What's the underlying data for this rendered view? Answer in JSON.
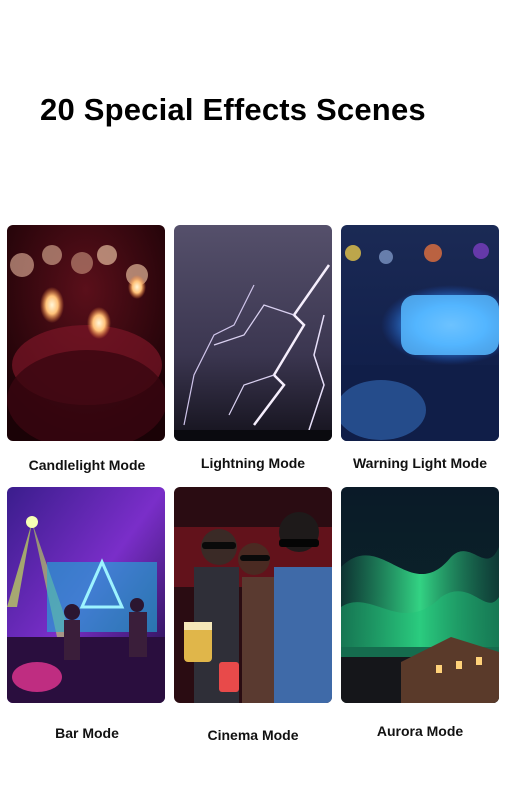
{
  "title": "20 Special Effects Scenes",
  "scenes": [
    {
      "label": "Candlelight Mode"
    },
    {
      "label": "Lightning Mode"
    },
    {
      "label": "Warning Light Mode"
    },
    {
      "label": "Bar Mode"
    },
    {
      "label": "Cinema Mode"
    },
    {
      "label": "Aurora Mode"
    }
  ]
}
